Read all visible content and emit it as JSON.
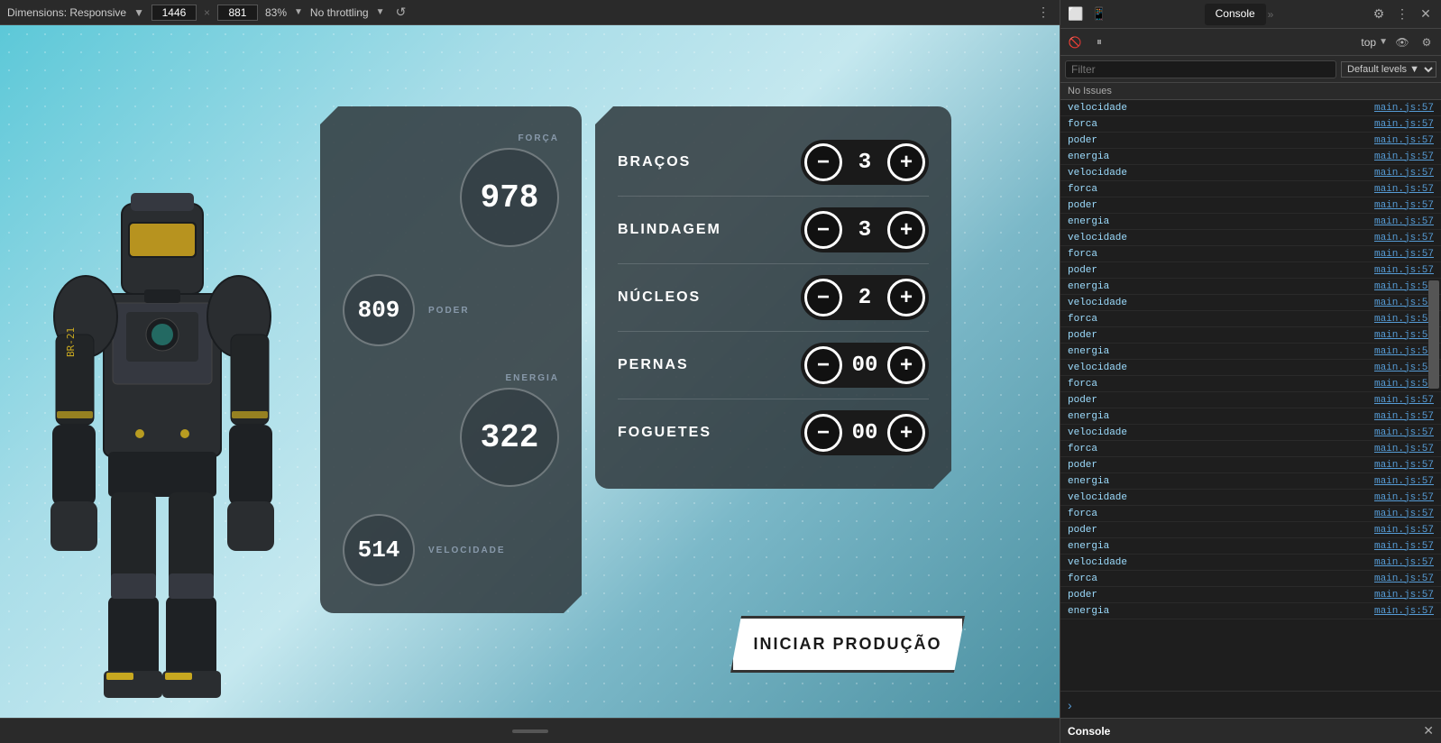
{
  "devtools": {
    "toolbar": {
      "dimensions_label": "Dimensions: Responsive",
      "width_value": "1446",
      "height_value": "881",
      "zoom_value": "83%",
      "throttling_value": "No throttling"
    },
    "right_panel": {
      "tabs": [
        {
          "label": "Console",
          "active": true
        }
      ],
      "secondary": {
        "context_label": "top"
      },
      "filter": {
        "placeholder": "Filter",
        "level_label": "Default levels"
      },
      "no_issues": "No Issues",
      "console_rows": [
        {
          "key": "velocidade",
          "file": "main.js:57"
        },
        {
          "key": "forca",
          "file": "main.js:57"
        },
        {
          "key": "poder",
          "file": "main.js:57"
        },
        {
          "key": "energia",
          "file": "main.js:57"
        },
        {
          "key": "velocidade",
          "file": "main.js:57"
        },
        {
          "key": "forca",
          "file": "main.js:57"
        },
        {
          "key": "poder",
          "file": "main.js:57"
        },
        {
          "key": "energia",
          "file": "main.js:57"
        },
        {
          "key": "velocidade",
          "file": "main.js:57"
        },
        {
          "key": "forca",
          "file": "main.js:57"
        },
        {
          "key": "poder",
          "file": "main.js:57"
        },
        {
          "key": "energia",
          "file": "main.js:57"
        },
        {
          "key": "velocidade",
          "file": "main.js:57"
        },
        {
          "key": "forca",
          "file": "main.js:57"
        },
        {
          "key": "poder",
          "file": "main.js:57"
        },
        {
          "key": "energia",
          "file": "main.js:57"
        },
        {
          "key": "velocidade",
          "file": "main.js:57"
        },
        {
          "key": "forca",
          "file": "main.js:57"
        },
        {
          "key": "poder",
          "file": "main.js:57"
        },
        {
          "key": "energia",
          "file": "main.js:57"
        },
        {
          "key": "velocidade",
          "file": "main.js:57"
        },
        {
          "key": "forca",
          "file": "main.js:57"
        },
        {
          "key": "poder",
          "file": "main.js:57"
        },
        {
          "key": "energia",
          "file": "main.js:57"
        },
        {
          "key": "velocidade",
          "file": "main.js:57"
        },
        {
          "key": "forca",
          "file": "main.js:57"
        },
        {
          "key": "poder",
          "file": "main.js:57"
        },
        {
          "key": "energia",
          "file": "main.js:57"
        },
        {
          "key": "velocidade",
          "file": "main.js:57"
        },
        {
          "key": "forca",
          "file": "main.js:57"
        },
        {
          "key": "poder",
          "file": "main.js:57"
        },
        {
          "key": "energia",
          "file": "main.js:57"
        }
      ],
      "bottom_tab": "Console"
    }
  },
  "game": {
    "stats": {
      "forca_label": "FORÇA",
      "forca_value": "978",
      "poder_label": "PODER",
      "poder_value": "809",
      "energia_label": "ENERGIA",
      "energia_value": "322",
      "velocidade_label": "VELOCIDADE",
      "velocidade_value": "514"
    },
    "controls": [
      {
        "name": "BRAÇOS",
        "value": "3"
      },
      {
        "name": "BLINDAGEM",
        "value": "3"
      },
      {
        "name": "NÚCLEOS",
        "value": "2"
      },
      {
        "name": "PERNAS",
        "value": "00"
      },
      {
        "name": "FOGUETES",
        "value": "00"
      }
    ],
    "start_button": "INICIAR PRODUÇÃO",
    "minus_symbol": "−",
    "plus_symbol": "+"
  }
}
